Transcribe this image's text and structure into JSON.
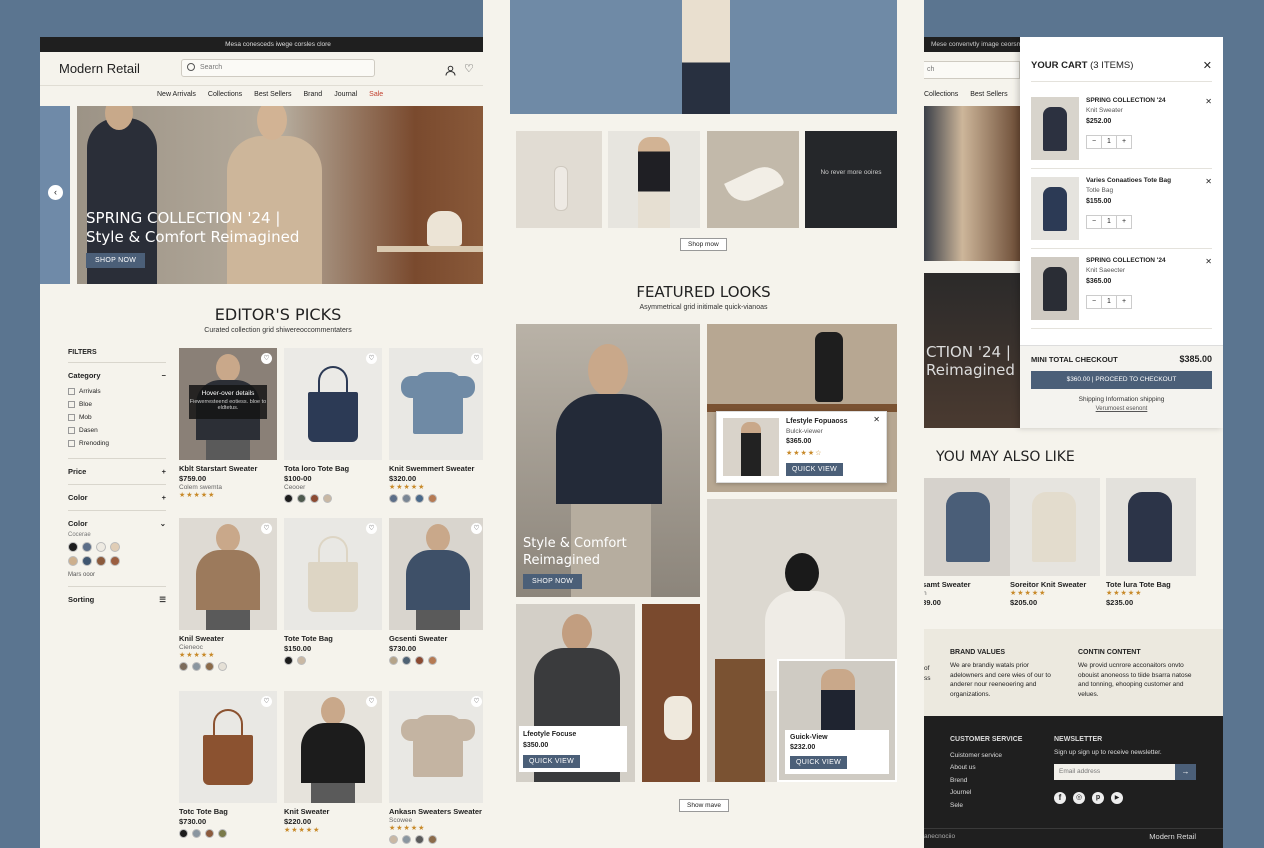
{
  "left": {
    "announcement": "Mesa conesceds iwege corsles clore",
    "logo": "Modern Retail",
    "search_placeholder": "Search",
    "cart_count": "3",
    "nav": [
      {
        "label": "New Arrivals"
      },
      {
        "label": "Collections"
      },
      {
        "label": "Best Sellers"
      },
      {
        "label": "Brand"
      },
      {
        "label": "Journal"
      },
      {
        "label": "Sale"
      }
    ],
    "hero_title_1": "SPRING COLLECTION '24 |",
    "hero_title_2": "Style & Comfort Reimagined",
    "hero_button": "SHOP NOW",
    "editors_title": "EDITOR'S PICKS",
    "editors_sub": "Curated collection grid shiwereoccommentaters",
    "filters_title": "FILTERS",
    "category_label": "Category",
    "categories": [
      {
        "label": "Arrivals"
      },
      {
        "label": "Bloe"
      },
      {
        "label": "Mob"
      },
      {
        "label": "Dasen"
      },
      {
        "label": "Rrenoding"
      }
    ],
    "price_label": "Price",
    "color_label_1": "Color",
    "color_label_2": "Color",
    "color_sub": "Cocerae",
    "more_color": "Mars ooor",
    "sorting_label": "Sorting",
    "swatches": [
      "#1c1c1c",
      "#5c6e88",
      "#eeeae2",
      "#e0cdb6",
      "#cdb08e",
      "#3f5670",
      "#8b5a3c",
      "#9b5e40"
    ],
    "hover_title": "Hover-over details",
    "hover_text": "Fiewerresteend eotiess. bloe to eldtetus.",
    "products": [
      {
        "name": "Kblt Starstart Sweater",
        "price": "$759.00",
        "sub": "Colem swemta",
        "stars": "★★★★★",
        "dots": [],
        "bg": "#8a8077",
        "fig": "#2c2f36",
        "type": "person"
      },
      {
        "name": "Tota loro Tote Bag",
        "price": "$100-00",
        "sub": "Ceooer",
        "stars": "",
        "dots": [
          "#1c1c1c",
          "#4e5a4e",
          "#8b4a32",
          "#c9b8a4"
        ],
        "bg": "#ebeae6",
        "fig": "#2c3a55",
        "type": "bag"
      },
      {
        "name": "Knit Swemmert Sweater",
        "price": "$320.00",
        "sub": "",
        "stars": "★★★★★",
        "dots": [
          "#5c6e88",
          "#7a8694",
          "#4b6a8a",
          "#b57a53"
        ],
        "bg": "#e9e8e4",
        "fig": "#6f8aa5",
        "type": "sweater"
      },
      {
        "name": "Knil Sweater",
        "price": "",
        "sub": "Cieneoc",
        "stars": "★★★★★",
        "dots": [
          "#7c6c5c",
          "#8a96a0",
          "#8b6b4a",
          "#e5e0d6"
        ],
        "bg": "#dedad3",
        "fig": "#9c7a5c",
        "type": "person"
      },
      {
        "name": "Tote Tote Bag",
        "price": "$150.00",
        "sub": "",
        "stars": "",
        "dots": [
          "#1c1c1c",
          "#c9b8a4"
        ],
        "bg": "#e9e8e4",
        "fig": "#ddd5c4",
        "type": "bag"
      },
      {
        "name": "Gcsenti Sweater",
        "price": "$730.00",
        "sub": "",
        "stars": "",
        "dots": [
          "#b5a48a",
          "#4e6274",
          "#8b4a32",
          "#b57a53"
        ],
        "bg": "#d9d5ce",
        "fig": "#3e5068",
        "type": "person"
      },
      {
        "name": "Totc Tote Bag",
        "price": "$730.00",
        "sub": "",
        "stars": "",
        "dots": [
          "#1c1c1c",
          "#8a96a0",
          "#8b5a3c",
          "#7a7a4a"
        ],
        "bg": "#e9e8e4",
        "fig": "#8b5230",
        "type": "bag"
      },
      {
        "name": "Knit Sweater",
        "price": "$220.00",
        "sub": "",
        "stars": "★★★★★",
        "dots": [],
        "bg": "#e6e3dc",
        "fig": "#1c1c1c",
        "type": "person"
      },
      {
        "name": "Ankasn Sweaters Sweater",
        "price": "",
        "sub": "Scowee",
        "stars": "★★★★★",
        "dots": [
          "#c9b8a4",
          "#8a96a0",
          "#5a5a5a",
          "#8b6b4a"
        ],
        "bg": "#e9e8e4",
        "fig": "#c4b4a2",
        "type": "sweater"
      }
    ]
  },
  "middle": {
    "strip_text": "No rever more ooires",
    "shop_btn_1": "Shop mow",
    "featured_title": "FEATURED LOOKS",
    "featured_sub": "Asymmetrical grid initimale quick-vianoas",
    "style_title_1": "Style & Comfort",
    "style_title_2": "Reimagined",
    "style_button": "SHOP NOW",
    "popup_title": "Lfestyle Fopuaoss",
    "popup_sub": "Bulck-viewer",
    "popup_price": "$365.00",
    "popup_stars": "★★★★☆",
    "popup_button": "QUICK VIEW",
    "card1_title": "Lfeotyle Focuse",
    "card1_price": "$350.00",
    "card1_button": "QUICK VIEW",
    "card2_title": "Guick-View",
    "card2_price": "$232.00",
    "card2_button": "QUICK VIEW",
    "shop_btn_2": "Show mave"
  },
  "right": {
    "cart_title": "YOUR CART",
    "cart_count": "(3 ITEMS)",
    "items": [
      {
        "name": "SPRING COLLECTION '24",
        "sub": "Knit Sweater",
        "price": "$252.00",
        "qty": "1",
        "bg": "#d8d4cc",
        "fig": "#2c3140"
      },
      {
        "name": "Varies Conaatioes Tote Bag",
        "sub": "Totle Bag",
        "price": "$155.00",
        "qty": "1",
        "bg": "#e5e3de",
        "fig": "#2c3a55"
      },
      {
        "name": "SPRING COLLECTION '24",
        "sub": "Knit Saeecter",
        "price": "$365.00",
        "qty": "1",
        "bg": "#cfcac2",
        "fig": "#2a2d35"
      }
    ],
    "mini_label": "MINI TOTAL CHECKOUT",
    "mini_total": "$385.00",
    "checkout_btn": "$360.00 | PROCEED TO CHECKOUT",
    "shipping_info": "Shipping Information shipping",
    "shipping_link": "Verumoest esenont",
    "bg_search": "ch",
    "bg_nav_1": "Collections",
    "bg_nav_2": "Best Sellers",
    "bg_announcement": "Mese convenvtly image ceorsmo",
    "hero_partial_1": "CTION '24 |",
    "hero_partial_2": "Reimagined",
    "also_like": "YOU MAY ALSO LIKE",
    "also_items": [
      {
        "name": "esamt Sweater",
        "sub": "ion",
        "price": "289.00",
        "stars": "",
        "bg": "#d6d2cc",
        "fig": "#4a5e78"
      },
      {
        "name": "Soreitor Knit Sweater",
        "sub": "",
        "price": "$205.00",
        "stars": "★★★★★",
        "bg": "#e6e4df",
        "fig": "#e3dccd"
      },
      {
        "name": "Tote lura Tote Bag",
        "sub": "",
        "price": "$235.00",
        "stars": "★★★★★",
        "bg": "#e3e1dc",
        "fig": "#2c3448"
      }
    ],
    "frag_1": "of",
    "frag_2": "ss",
    "brand_values_title": "BRAND VALUES",
    "brand_values_text": "We are brandiy watals prior adelowners and cere wies of our to anderer nour reeneoering and organizations.",
    "content_title": "CONTIN CONTENT",
    "content_text": "We provid ucnrore acconaitors onvto obouist anoneoss to tiide bsarra natose and tonning, ehooping customer and velues.",
    "cs_title": "CUSTOMER SERVICE",
    "cs_links": [
      {
        "label": "Cuistomer service"
      },
      {
        "label": "About us"
      },
      {
        "label": "Brend"
      },
      {
        "label": "Journel"
      },
      {
        "label": "Sele"
      }
    ],
    "news_title": "NEWSLETTER",
    "news_text": "Sign up sign up to receive newsletter.",
    "email_placeholder": "Email address",
    "footer_left": "anecnociio",
    "footer_brand": "Modern Retail"
  }
}
